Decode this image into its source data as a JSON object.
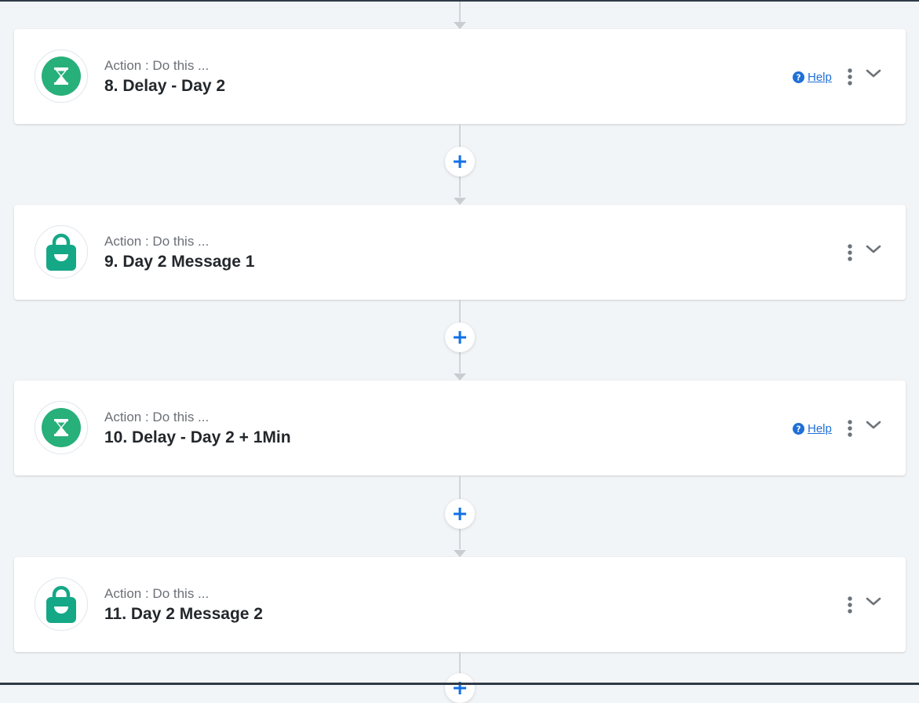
{
  "workflow": {
    "steps": [
      {
        "kind": "delay",
        "subtitle": "Action : Do this ...",
        "title": "8. Delay - Day 2",
        "help_label": "Help",
        "icon": "hourglass-icon"
      },
      {
        "kind": "message",
        "subtitle": "Action : Do this ...",
        "title": "9. Day 2 Message 1",
        "icon": "shopping-bag-icon"
      },
      {
        "kind": "delay",
        "subtitle": "Action : Do this ...",
        "title": "10. Delay - Day 2 + 1Min",
        "help_label": "Help",
        "icon": "hourglass-icon"
      },
      {
        "kind": "message",
        "subtitle": "Action : Do this ...",
        "title": "11. Day 2 Message 2",
        "icon": "shopping-bag-icon"
      }
    ],
    "add_step_symbol": "+"
  },
  "colors": {
    "background": "#f2f5f8",
    "delay_icon": "#27b07a",
    "message_icon": "#14a887",
    "link": "#1f6fd6",
    "add_button": "#1170e6"
  }
}
